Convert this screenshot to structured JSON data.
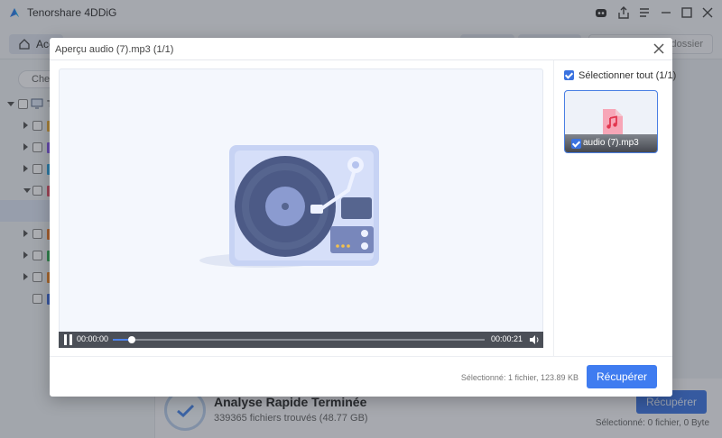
{
  "app": {
    "name": "Tenorshare 4DDiG",
    "home_label": "Acc",
    "folder_label": "dossier",
    "search_label": "Cher",
    "tree_label": "T"
  },
  "background": {
    "scan_title": "Analyse Rapide Terminée",
    "scan_sub": "339365 fichiers trouvés (48.77 GB)",
    "recover_label": "Récupérer",
    "selected_text": "Sélectionné: 0 fichier, 0 Byte"
  },
  "dialog": {
    "title": "Aperçu audio (7).mp3 (1/1)",
    "select_all_label": "Sélectionner tout (1/1)",
    "thumb_name": "audio (7).mp3",
    "status_text": "Sélectionné: 1 fichier, 123.89 KB",
    "recover_label": "Récupérer"
  },
  "player": {
    "current_time": "00:00:00",
    "total_time": "00:00:21",
    "progress": 0.05
  },
  "colors": {
    "accent": "#3f7cf0",
    "player_bar": "#4b4f57",
    "preview_bg": "#f4f7fd"
  }
}
